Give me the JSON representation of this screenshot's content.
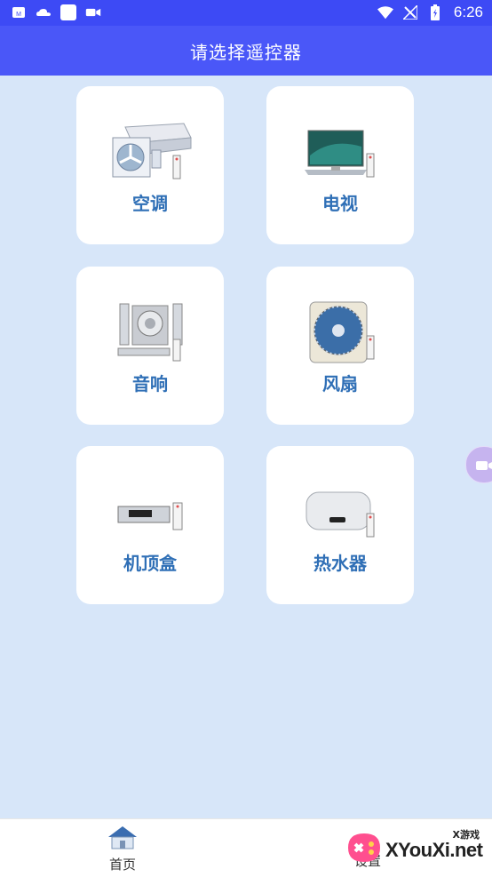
{
  "status_bar": {
    "time": "6:26",
    "left_icons": [
      "app-icon",
      "cloud-icon",
      "white-square-icon",
      "video-icon"
    ],
    "right_icons": [
      "wifi-icon",
      "no-signal-icon",
      "battery-icon"
    ]
  },
  "app_bar": {
    "title": "请选择遥控器"
  },
  "devices": [
    {
      "label": "空调",
      "icon": "air-conditioner-icon"
    },
    {
      "label": "电视",
      "icon": "tv-icon"
    },
    {
      "label": "音响",
      "icon": "speaker-icon"
    },
    {
      "label": "风扇",
      "icon": "fan-icon"
    },
    {
      "label": "机顶盒",
      "icon": "set-top-box-icon"
    },
    {
      "label": "热水器",
      "icon": "water-heater-icon"
    }
  ],
  "bottom_nav": {
    "home_label": "首页",
    "settings_label": "设置"
  },
  "watermark": {
    "text": "XYouXi.net",
    "small": "X游戏"
  },
  "colors": {
    "appbar": "#4a57f8",
    "statusbar": "#3d4af5",
    "background": "#d7e6f9",
    "label": "#2f6fb6"
  }
}
